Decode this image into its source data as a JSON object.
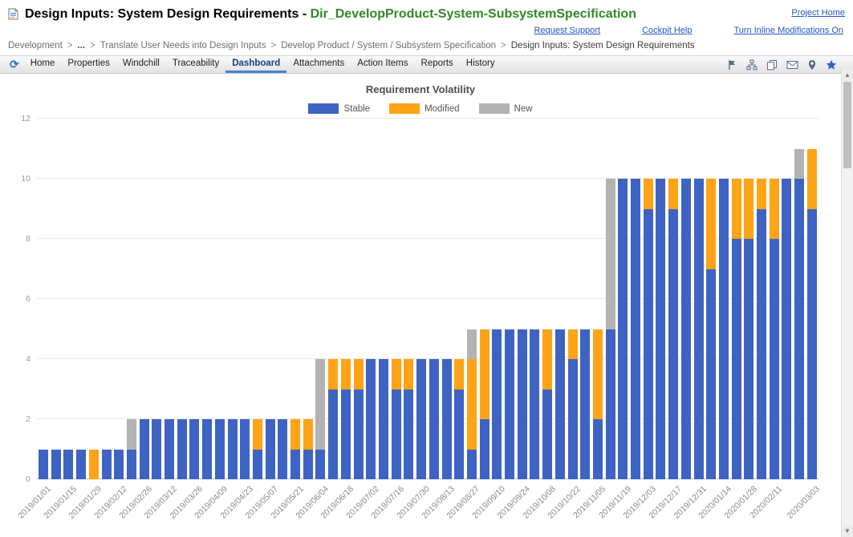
{
  "header": {
    "title_prefix": "Design Inputs: System Design Requirements",
    "title_separator": " - ",
    "title_object": "Dir_DevelopProduct-System-SubsystemSpecification",
    "links": {
      "project_home": "Project Home",
      "request_support": "Request Support",
      "cockpit_help": "Cockpit Help",
      "inline_modifications": "Turn Inline Modifications On"
    }
  },
  "breadcrumb": {
    "separator": ">",
    "items": [
      "Development",
      "...",
      "Translate User Needs into Design Inputs",
      "Develop Product / System / Subsystem Specification",
      "Design Inputs: System Design Requirements"
    ]
  },
  "tabs": {
    "items": [
      "Home",
      "Properties",
      "Windchill",
      "Traceability",
      "Dashboard",
      "Attachments",
      "Action Items",
      "Reports",
      "History"
    ],
    "active": "Dashboard",
    "right_icons": [
      "flag-icon",
      "sitemap-icon",
      "copy-icon",
      "email-icon",
      "location-pin-icon",
      "favorite-star-icon"
    ]
  },
  "colors": {
    "title_object_green": "#2F8A25",
    "link_blue": "#2457C5",
    "tab_active_underline": "#4A7FD4",
    "stable_blue": "#3E63C3",
    "modified_orange": "#FFA317",
    "new_gray": "#B3B3B3"
  },
  "chart_data": {
    "type": "bar",
    "stacked": true,
    "title": "Requirement Volatility",
    "legend": [
      {
        "label": "Stable",
        "color": "#3E63C3"
      },
      {
        "label": "Modified",
        "color": "#FFA317"
      },
      {
        "label": "New",
        "color": "#B3B3B3"
      }
    ],
    "ylim": [
      0,
      12
    ],
    "y_ticks": [
      0,
      2,
      4,
      6,
      8,
      10,
      12
    ],
    "grid": true,
    "bar_format": [
      "x_label (empty = unlabeled weekly bar)",
      "stable",
      "modified",
      "new"
    ],
    "bars": [
      [
        "2019/01/01",
        1,
        0,
        0
      ],
      [
        "",
        1,
        0,
        0
      ],
      [
        "2019/01/15",
        1,
        0,
        0
      ],
      [
        "",
        1,
        0,
        0
      ],
      [
        "2019/01/29",
        0,
        1,
        0
      ],
      [
        "",
        1,
        0,
        0
      ],
      [
        "2019/02/12",
        1,
        0,
        0
      ],
      [
        "",
        1,
        0,
        1
      ],
      [
        "2019/02/26",
        2,
        0,
        0
      ],
      [
        "",
        2,
        0,
        0
      ],
      [
        "2019/03/12",
        2,
        0,
        0
      ],
      [
        "",
        2,
        0,
        0
      ],
      [
        "2019/03/26",
        2,
        0,
        0
      ],
      [
        "",
        2,
        0,
        0
      ],
      [
        "2019/04/09",
        2,
        0,
        0
      ],
      [
        "",
        2,
        0,
        0
      ],
      [
        "2019/04/23",
        2,
        0,
        0
      ],
      [
        "",
        1,
        1,
        0
      ],
      [
        "2019/05/07",
        2,
        0,
        0
      ],
      [
        "",
        2,
        0,
        0
      ],
      [
        "2019/05/21",
        1,
        1,
        0
      ],
      [
        "",
        1,
        1,
        0
      ],
      [
        "2019/06/04",
        1,
        0,
        3
      ],
      [
        "",
        3,
        1,
        0
      ],
      [
        "2019/06/18",
        3,
        1,
        0
      ],
      [
        "",
        3,
        1,
        0
      ],
      [
        "2019/07/02",
        4,
        0,
        0
      ],
      [
        "",
        4,
        0,
        0
      ],
      [
        "2019/07/16",
        3,
        1,
        0
      ],
      [
        "",
        3,
        1,
        0
      ],
      [
        "2019/07/30",
        4,
        0,
        0
      ],
      [
        "",
        4,
        0,
        0
      ],
      [
        "2019/08/13",
        4,
        0,
        0
      ],
      [
        "",
        3,
        1,
        0
      ],
      [
        "2019/08/27",
        1,
        3,
        1
      ],
      [
        "",
        2,
        3,
        0
      ],
      [
        "2019/09/10",
        5,
        0,
        0
      ],
      [
        "",
        5,
        0,
        0
      ],
      [
        "2019/09/24",
        5,
        0,
        0
      ],
      [
        "",
        5,
        0,
        0
      ],
      [
        "2019/10/08",
        3,
        2,
        0
      ],
      [
        "",
        5,
        0,
        0
      ],
      [
        "2019/10/22",
        4,
        1,
        0
      ],
      [
        "",
        5,
        0,
        0
      ],
      [
        "2019/11/05",
        2,
        3,
        0
      ],
      [
        "",
        5,
        0,
        5
      ],
      [
        "2019/11/19",
        10,
        0,
        0
      ],
      [
        "",
        10,
        0,
        0
      ],
      [
        "2019/12/03",
        9,
        1,
        0
      ],
      [
        "",
        10,
        0,
        0
      ],
      [
        "2019/12/17",
        9,
        1,
        0
      ],
      [
        "",
        10,
        0,
        0
      ],
      [
        "2019/12/31",
        10,
        0,
        0
      ],
      [
        "",
        7,
        3,
        0
      ],
      [
        "2020/01/14",
        10,
        0,
        0
      ],
      [
        "",
        8,
        2,
        0
      ],
      [
        "2020/01/28",
        8,
        2,
        0
      ],
      [
        "",
        9,
        1,
        0
      ],
      [
        "2020/02/11",
        8,
        2,
        0
      ],
      [
        "",
        10,
        0,
        0
      ],
      [
        "",
        10,
        0,
        1
      ],
      [
        "2020/03/03",
        9,
        2,
        0
      ]
    ]
  }
}
